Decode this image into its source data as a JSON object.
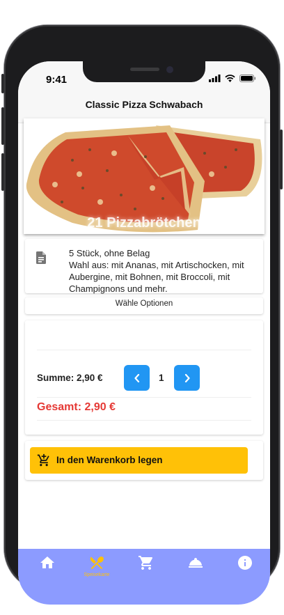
{
  "status": {
    "time": "9:41"
  },
  "header": {
    "title": "Classic Pizza Schwabach"
  },
  "product": {
    "image_caption": "21 Pizzabrötchen",
    "desc_line1": "5 Stück, ohne Belag",
    "desc_line2": "Wahl aus: mit Ananas, mit Artischocken, mit Aubergine, mit Bohnen, mit Broccoli, mit Champignons und mehr."
  },
  "options": {
    "label": "Wähle Optionen"
  },
  "order": {
    "summe": "Summe: 2,90 €",
    "quantity": "1",
    "gesamt": "Gesamt: 2,90 €"
  },
  "cart_button": {
    "label": "In den Warenkorb legen"
  },
  "tabs": [
    {
      "icon": "home-icon",
      "label": ""
    },
    {
      "icon": "utensils-icon",
      "label": "Speisekarte",
      "active": true
    },
    {
      "icon": "cart-icon",
      "label": ""
    },
    {
      "icon": "dish-icon",
      "label": ""
    },
    {
      "icon": "info-icon",
      "label": ""
    }
  ],
  "colors": {
    "tabbar": "#8c9bff",
    "active_tab": "#ffc107",
    "stepper": "#2196f3",
    "total": "#e53935",
    "cart_button": "#ffc107"
  }
}
